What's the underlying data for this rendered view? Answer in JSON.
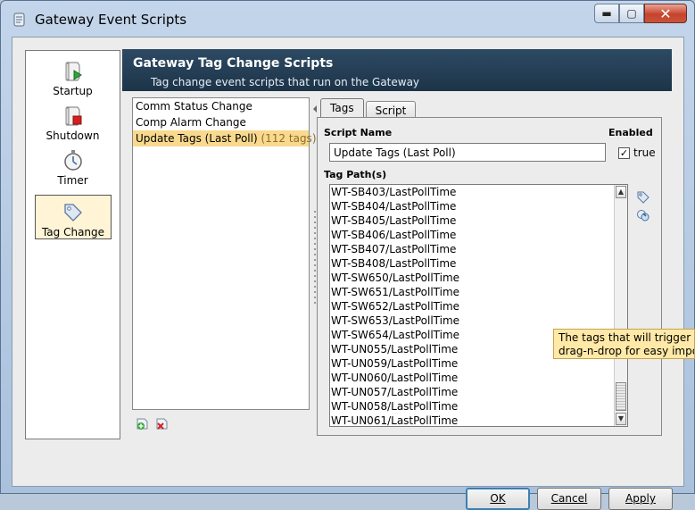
{
  "window": {
    "title": "Gateway Event Scripts",
    "min_glyph": "▬",
    "max_glyph": "▢",
    "close_glyph": "✕"
  },
  "nav": {
    "items": [
      {
        "label": "Startup",
        "icon": "startup-icon"
      },
      {
        "label": "Shutdown",
        "icon": "shutdown-icon"
      },
      {
        "label": "Timer",
        "icon": "timer-icon"
      },
      {
        "label": "Tag Change",
        "icon": "tag-change-icon",
        "selected": true
      }
    ]
  },
  "header": {
    "title": "Gateway Tag Change Scripts",
    "subtitle": "Tag change event scripts that run on the Gateway"
  },
  "scripts": {
    "items": [
      {
        "name": "Comm Status Change",
        "count": ""
      },
      {
        "name": "Comp Alarm Change",
        "count": ""
      },
      {
        "name": "Update Tags (Last Poll)",
        "count": "(112 tags)",
        "selected": true
      }
    ]
  },
  "tabs": [
    {
      "label": "Tags",
      "active": true
    },
    {
      "label": "Script",
      "active": false
    }
  ],
  "form": {
    "script_name_label": "Script Name",
    "script_name_value": "Update Tags (Last Poll)",
    "enabled_label": "Enabled",
    "enabled_checked": true,
    "enabled_value_label": "true",
    "tag_paths_label": "Tag Path(s)"
  },
  "tag_paths": [
    "WT-SB403/LastPollTime",
    "WT-SB404/LastPollTime",
    "WT-SB405/LastPollTime",
    "WT-SB406/LastPollTime",
    "WT-SB407/LastPollTime",
    "WT-SB408/LastPollTime",
    "WT-SW650/LastPollTime",
    "WT-SW651/LastPollTime",
    "WT-SW652/LastPollTime",
    "WT-SW653/LastPollTime",
    "WT-SW654/LastPollTime",
    "WT-UN055/LastPollTime",
    "WT-UN059/LastPollTime",
    "WT-UN060/LastPollTime",
    "WT-UN057/LastPollTime",
    "WT-UN058/LastPollTime",
    "WT-UN061/LastPollTime"
  ],
  "tooltip": {
    "line1": "The tags that will trigger this",
    "line2": "drag-n-drop for easy importi"
  },
  "buttons": {
    "ok": "OK",
    "cancel": "Cancel",
    "apply": "Apply"
  }
}
